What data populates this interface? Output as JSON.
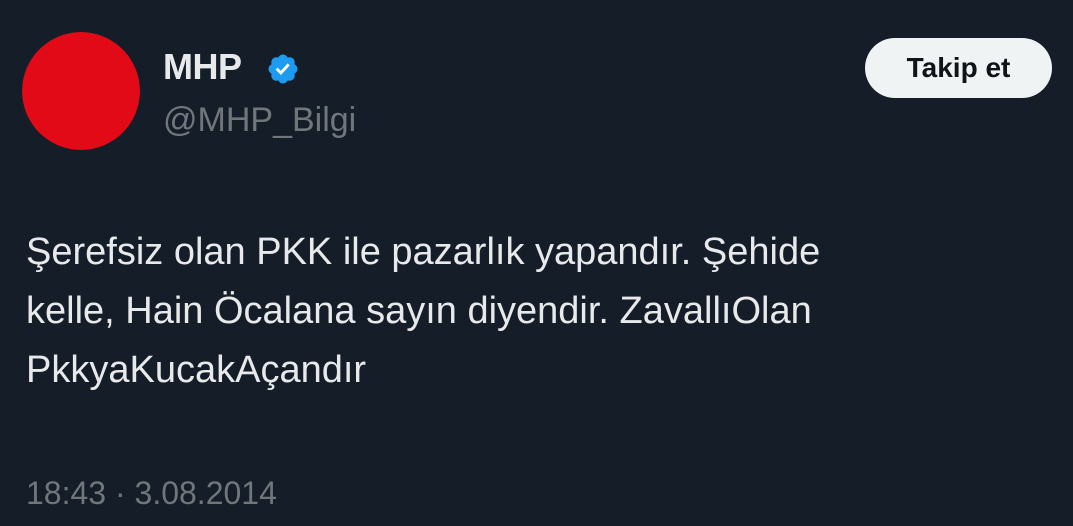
{
  "author": {
    "display_name": "MHP",
    "handle": "@MHP_Bilgi",
    "verified": true,
    "avatar_icon": "mhp-crescents-logo-icon",
    "verified_icon": "verified-badge-icon",
    "avatar_color": "#e30a17",
    "verified_color": "#1d9bf0"
  },
  "follow_button": {
    "label": "Takip et"
  },
  "tweet": {
    "lines": [
      "Şerefsiz olan PKK ile pazarlık yapandır. Şehide",
      "kelle, Hain Öcalana sayın diyendir. ZavallıOlan",
      "PkkyaKucakAçandır"
    ],
    "time": "18:43",
    "separator": "·",
    "date": "3.08.2014"
  },
  "colors": {
    "background": "#151d28",
    "primary_text": "#e7e9ea",
    "secondary_text": "#71767b",
    "button_bg": "#eff3f4"
  }
}
